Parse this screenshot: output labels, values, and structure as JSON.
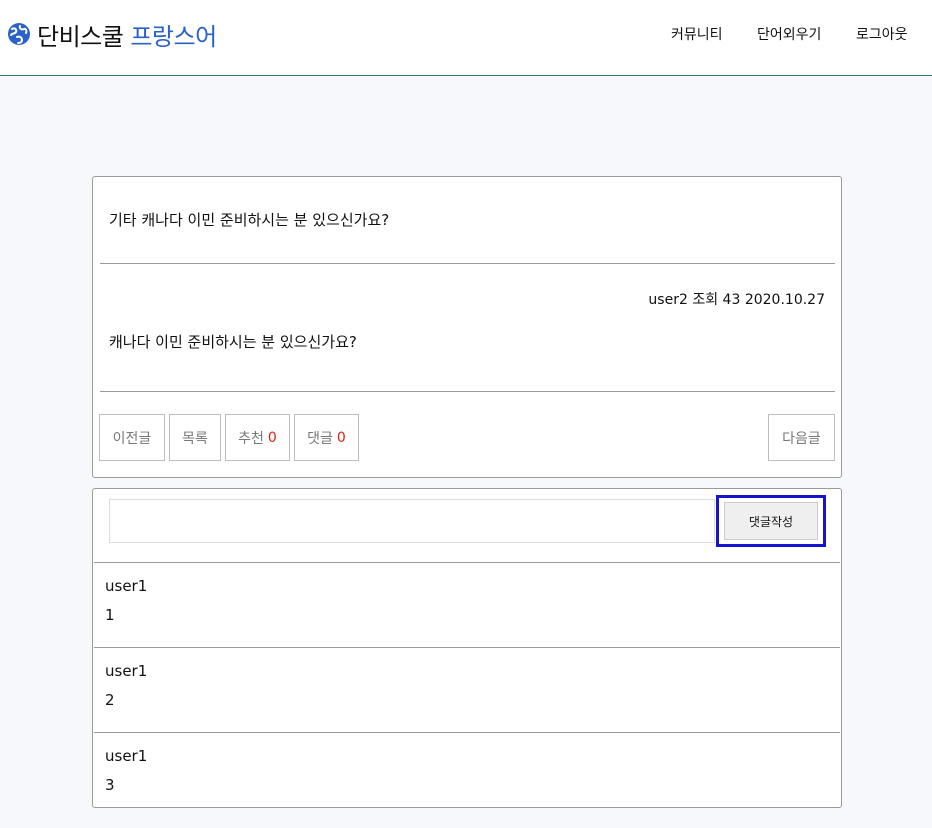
{
  "brand": {
    "name": "단비스쿨",
    "subject": "프랑스어",
    "icon": "globe-icon",
    "accent": "#2a62c9"
  },
  "nav": [
    "커뮤니티",
    "단어외우기",
    "로그아웃"
  ],
  "post": {
    "title": "기타 캐나다 이민 준비하시는 분 있으신가요?",
    "author": "user2",
    "views_label": "조회",
    "views": "43",
    "date": "2020.10.27",
    "body": "캐나다 이민 준비하시는 분 있으신가요?"
  },
  "actions": {
    "prev": "이전글",
    "list": "목록",
    "recommend": "추천",
    "recommend_count": "0",
    "comments": "댓글",
    "comments_count": "0",
    "next": "다음글"
  },
  "comment_form": {
    "input_value": "",
    "submit": "댓글작성",
    "highlight_color": "#1515d0"
  },
  "comments": [
    {
      "author": "user1",
      "text": "1"
    },
    {
      "author": "user1",
      "text": "2"
    },
    {
      "author": "user1",
      "text": "3"
    }
  ]
}
